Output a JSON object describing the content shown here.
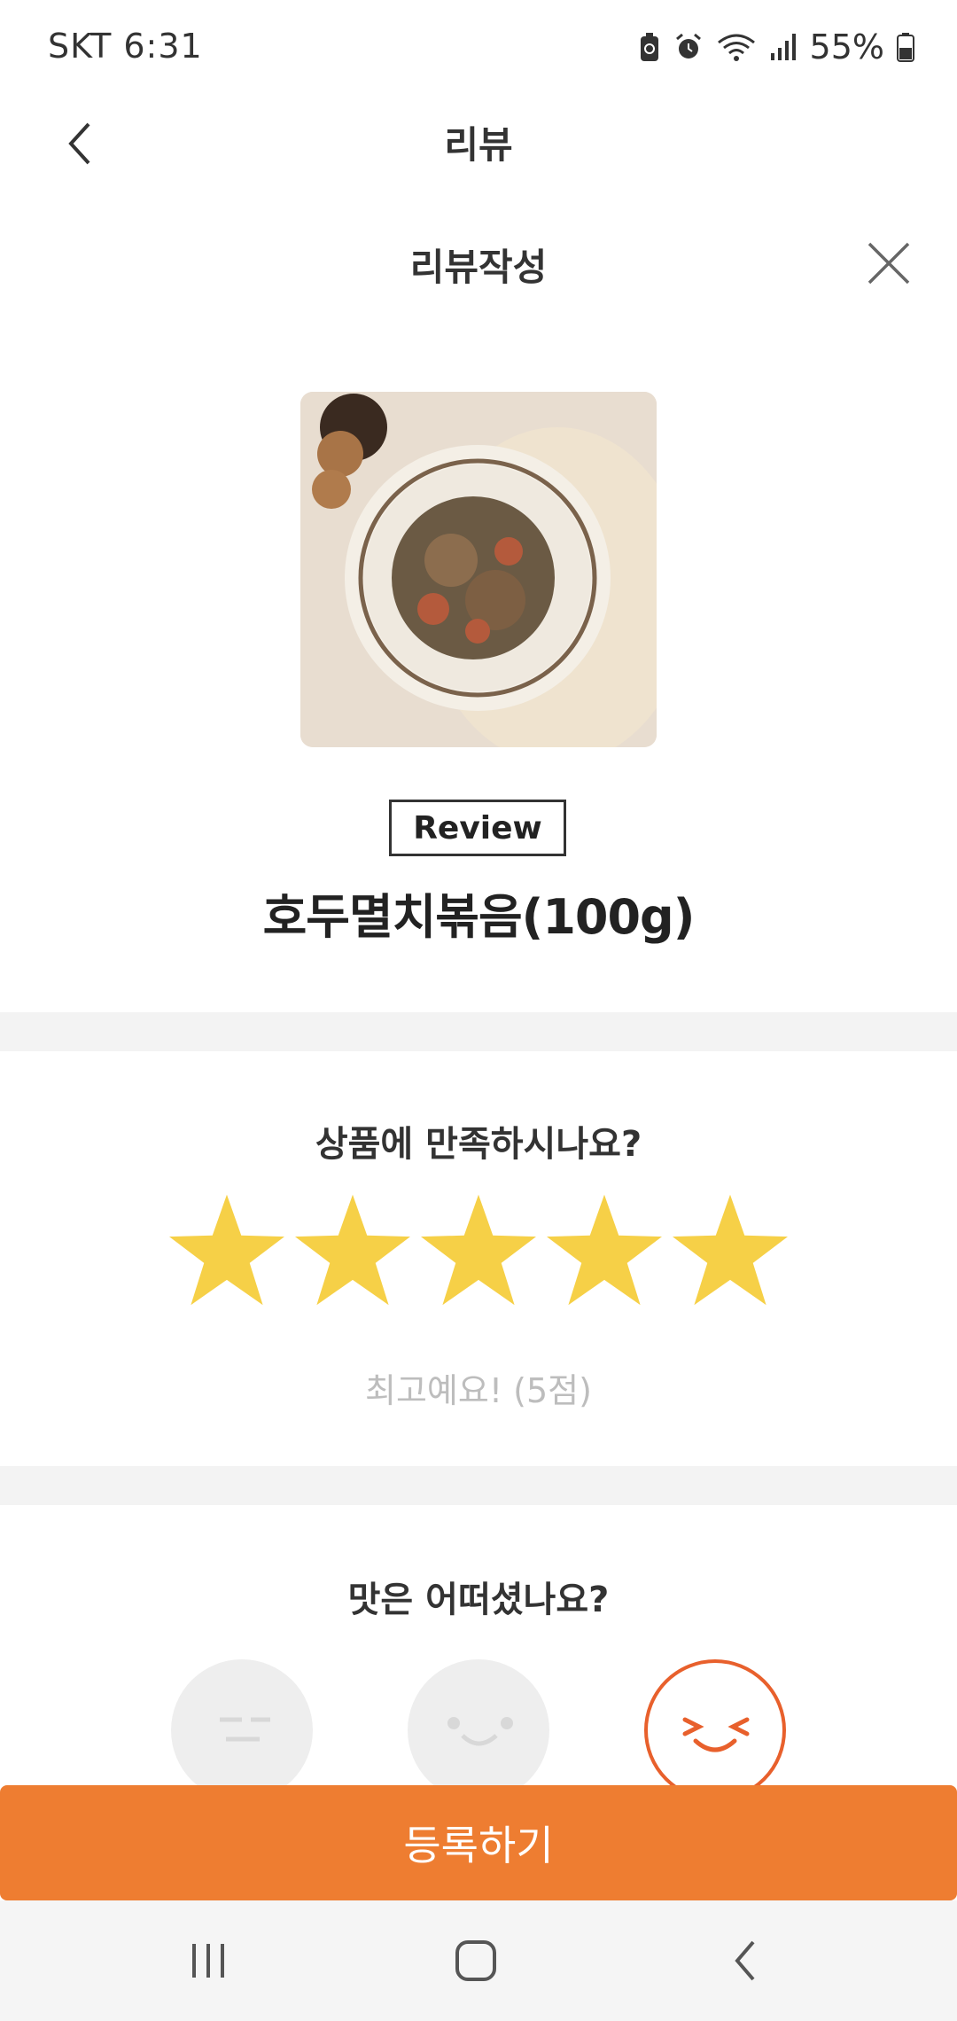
{
  "status_bar": {
    "carrier_time": "SKT 6:31",
    "battery": "55%"
  },
  "header": {
    "title": "리뷰"
  },
  "review_form": {
    "title": "리뷰작성",
    "tag": "Review",
    "product_name": "호두멸치볶음(100g)"
  },
  "rating": {
    "question": "상품에 만족하시나요?",
    "stars": 5,
    "max_stars": 5,
    "caption": "최고예요! (5점)"
  },
  "taste": {
    "question": "맛은 어떠셨나요?",
    "selected_index": 2,
    "options": [
      "neutral-face-icon",
      "smile-face-icon",
      "laughing-face-icon"
    ]
  },
  "actions": {
    "register_label": "등록하기"
  },
  "colors": {
    "accent": "#ee7d31",
    "star": "#f6d047",
    "selected_face": "#e8602c"
  }
}
